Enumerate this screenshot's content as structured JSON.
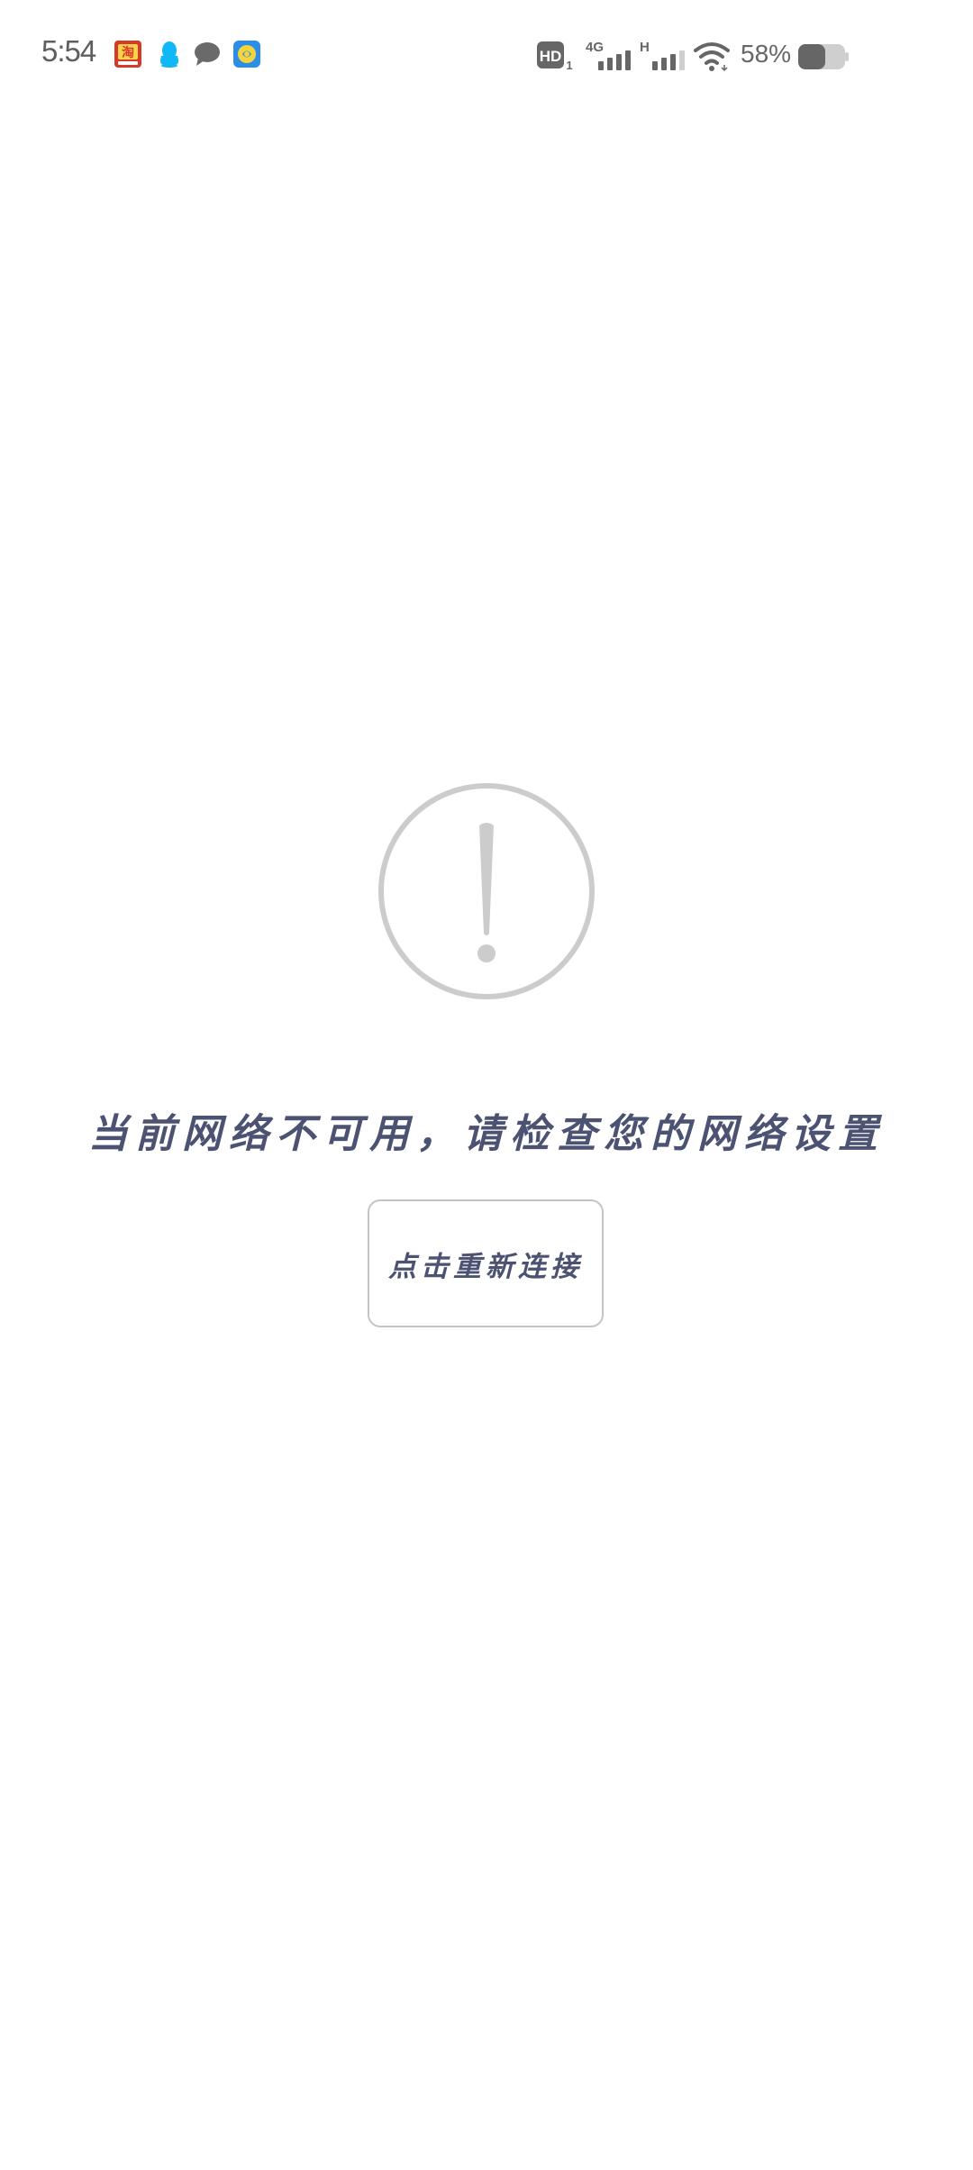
{
  "status_bar": {
    "time": "5:54",
    "notifications": [
      {
        "name": "taobao-app-icon",
        "color": "#d83a2a"
      },
      {
        "name": "qq-app-icon",
        "color": "#12b7f5"
      },
      {
        "name": "message-bubble-icon",
        "color": "#6a6a6a"
      },
      {
        "name": "browser-app-icon",
        "color": "#2a8ee8"
      }
    ],
    "hd_label": "HD",
    "hd_sub": "1",
    "network_4g_label": "4G",
    "network_h_label": "H",
    "battery_percent": "58%",
    "battery_level": 0.58
  },
  "main": {
    "icon": "exclamation-circle-icon",
    "message": "当前网络不可用，请检查您的网络设置",
    "reconnect_label": "点击重新连接"
  },
  "colors": {
    "text_accent": "#4c5272",
    "icon_gray": "#cccccc",
    "status_gray": "#666666"
  }
}
